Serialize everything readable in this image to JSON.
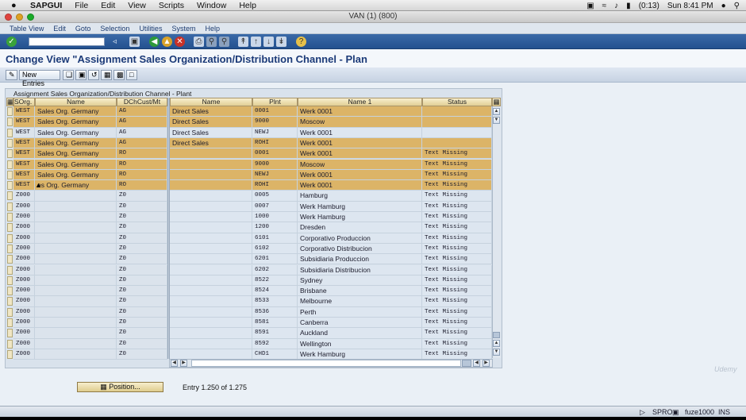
{
  "mac_menubar": {
    "app": "SAPGUI",
    "menus": [
      "File",
      "Edit",
      "View",
      "Scripts",
      "Window",
      "Help"
    ],
    "battery": "(0:13)",
    "clock": "Sun 8:41 PM"
  },
  "window": {
    "title": "VAN (1) (800)"
  },
  "sap_menu": [
    "Table View",
    "Edit",
    "Goto",
    "Selection",
    "Utilities",
    "System",
    "Help"
  ],
  "page": {
    "title": "Change View \"Assignment Sales Organization/Distribution Channel - Plan"
  },
  "toolbar2": {
    "new_entries": "New Entries"
  },
  "table": {
    "caption": "Assignment Sales Organization/Distribution Channel - Plant",
    "columns": [
      "SOrg.",
      "Name",
      "DChCust/Mt",
      "Name",
      "Plnt",
      "Name 1",
      "Status"
    ],
    "rows": [
      {
        "sorg": "WEST",
        "name": "Sales Org. Germany",
        "dch": "AG",
        "dname": "Direct Sales",
        "plnt": "0001",
        "name1": "Werk 0001",
        "status": "",
        "hl": true
      },
      {
        "sorg": "WEST",
        "name": "Sales Org. Germany",
        "dch": "AG",
        "dname": "Direct Sales",
        "plnt": "9000",
        "name1": "Moscow",
        "status": "",
        "hl": true
      },
      {
        "sorg": "WEST",
        "name": "Sales Org. Germany",
        "dch": "AG",
        "dname": "Direct Sales",
        "plnt": "NEWJ",
        "name1": "Werk 0001",
        "status": "",
        "hl": false
      },
      {
        "sorg": "WEST",
        "name": "Sales Org. Germany",
        "dch": "AG",
        "dname": "Direct Sales",
        "plnt": "ROHI",
        "name1": "Werk 0001",
        "status": "",
        "hl": true
      },
      {
        "sorg": "WEST",
        "name": "Sales Org. Germany",
        "dch": "RO",
        "dname": "",
        "plnt": "0001",
        "name1": "Werk 0001",
        "status": "Text Missing",
        "hl": true
      },
      {
        "sorg": "WEST",
        "name": "Sales Org. Germany",
        "dch": "RO",
        "dname": "",
        "plnt": "9000",
        "name1": "Moscow",
        "status": "Text Missing",
        "hl": true
      },
      {
        "sorg": "WEST",
        "name": "Sales Org. Germany",
        "dch": "RO",
        "dname": "",
        "plnt": "NEWJ",
        "name1": "Werk 0001",
        "status": "Text Missing",
        "hl": true
      },
      {
        "sorg": "WEST",
        "name": "es Org. Germany",
        "dch": "RO",
        "dname": "",
        "plnt": "ROHI",
        "name1": "Werk 0001",
        "status": "Text Missing",
        "hl": true
      },
      {
        "sorg": "Z000",
        "name": "",
        "dch": "Z0",
        "dname": "",
        "plnt": "0005",
        "name1": "Hamburg",
        "status": "Text Missing",
        "hl": false
      },
      {
        "sorg": "Z000",
        "name": "",
        "dch": "Z0",
        "dname": "",
        "plnt": "0007",
        "name1": "Werk Hamburg",
        "status": "Text Missing",
        "hl": false
      },
      {
        "sorg": "Z000",
        "name": "",
        "dch": "Z0",
        "dname": "",
        "plnt": "1000",
        "name1": "Werk Hamburg",
        "status": "Text Missing",
        "hl": false
      },
      {
        "sorg": "Z000",
        "name": "",
        "dch": "Z0",
        "dname": "",
        "plnt": "1200",
        "name1": "Dresden",
        "status": "Text Missing",
        "hl": false
      },
      {
        "sorg": "Z000",
        "name": "",
        "dch": "Z0",
        "dname": "",
        "plnt": "6101",
        "name1": "Corporativo Produccion",
        "status": "Text Missing",
        "hl": false
      },
      {
        "sorg": "Z000",
        "name": "",
        "dch": "Z0",
        "dname": "",
        "plnt": "6102",
        "name1": "Corporativo Distribucion",
        "status": "Text Missing",
        "hl": false
      },
      {
        "sorg": "Z000",
        "name": "",
        "dch": "Z0",
        "dname": "",
        "plnt": "6201",
        "name1": "Subsidiaria Produccion",
        "status": "Text Missing",
        "hl": false
      },
      {
        "sorg": "Z000",
        "name": "",
        "dch": "Z0",
        "dname": "",
        "plnt": "6202",
        "name1": "Subsidiaria Distribucion",
        "status": "Text Missing",
        "hl": false
      },
      {
        "sorg": "Z000",
        "name": "",
        "dch": "Z0",
        "dname": "",
        "plnt": "8522",
        "name1": "Sydney",
        "status": "Text Missing",
        "hl": false
      },
      {
        "sorg": "Z000",
        "name": "",
        "dch": "Z0",
        "dname": "",
        "plnt": "8524",
        "name1": "Brisbane",
        "status": "Text Missing",
        "hl": false
      },
      {
        "sorg": "Z000",
        "name": "",
        "dch": "Z0",
        "dname": "",
        "plnt": "8533",
        "name1": "Melbourne",
        "status": "Text Missing",
        "hl": false
      },
      {
        "sorg": "Z000",
        "name": "",
        "dch": "Z0",
        "dname": "",
        "plnt": "8536",
        "name1": "Perth",
        "status": "Text Missing",
        "hl": false
      },
      {
        "sorg": "Z000",
        "name": "",
        "dch": "Z0",
        "dname": "",
        "plnt": "8581",
        "name1": "Canberra",
        "status": "Text Missing",
        "hl": false
      },
      {
        "sorg": "Z000",
        "name": "",
        "dch": "Z0",
        "dname": "",
        "plnt": "8591",
        "name1": "Auckland",
        "status": "Text Missing",
        "hl": false
      },
      {
        "sorg": "Z000",
        "name": "",
        "dch": "Z0",
        "dname": "",
        "plnt": "8592",
        "name1": "Wellington",
        "status": "Text Missing",
        "hl": false
      },
      {
        "sorg": "Z000",
        "name": "",
        "dch": "Z0",
        "dname": "",
        "plnt": "CHD1",
        "name1": "Werk Hamburg",
        "status": "Text Missing",
        "hl": false
      }
    ]
  },
  "position_button": "Position...",
  "entry_text": "Entry 1.250 of 1.275",
  "statusbar": {
    "tcode": "SPRO",
    "server": "fuze1000",
    "mode": "INS"
  },
  "watermark": "Udemy",
  "colors": {
    "highlight_row": "#dcb467",
    "normal_row": "#dde6f0",
    "header": "#e2cf95",
    "toolbar": "#2f5f9e",
    "title": "#1b3a78"
  }
}
